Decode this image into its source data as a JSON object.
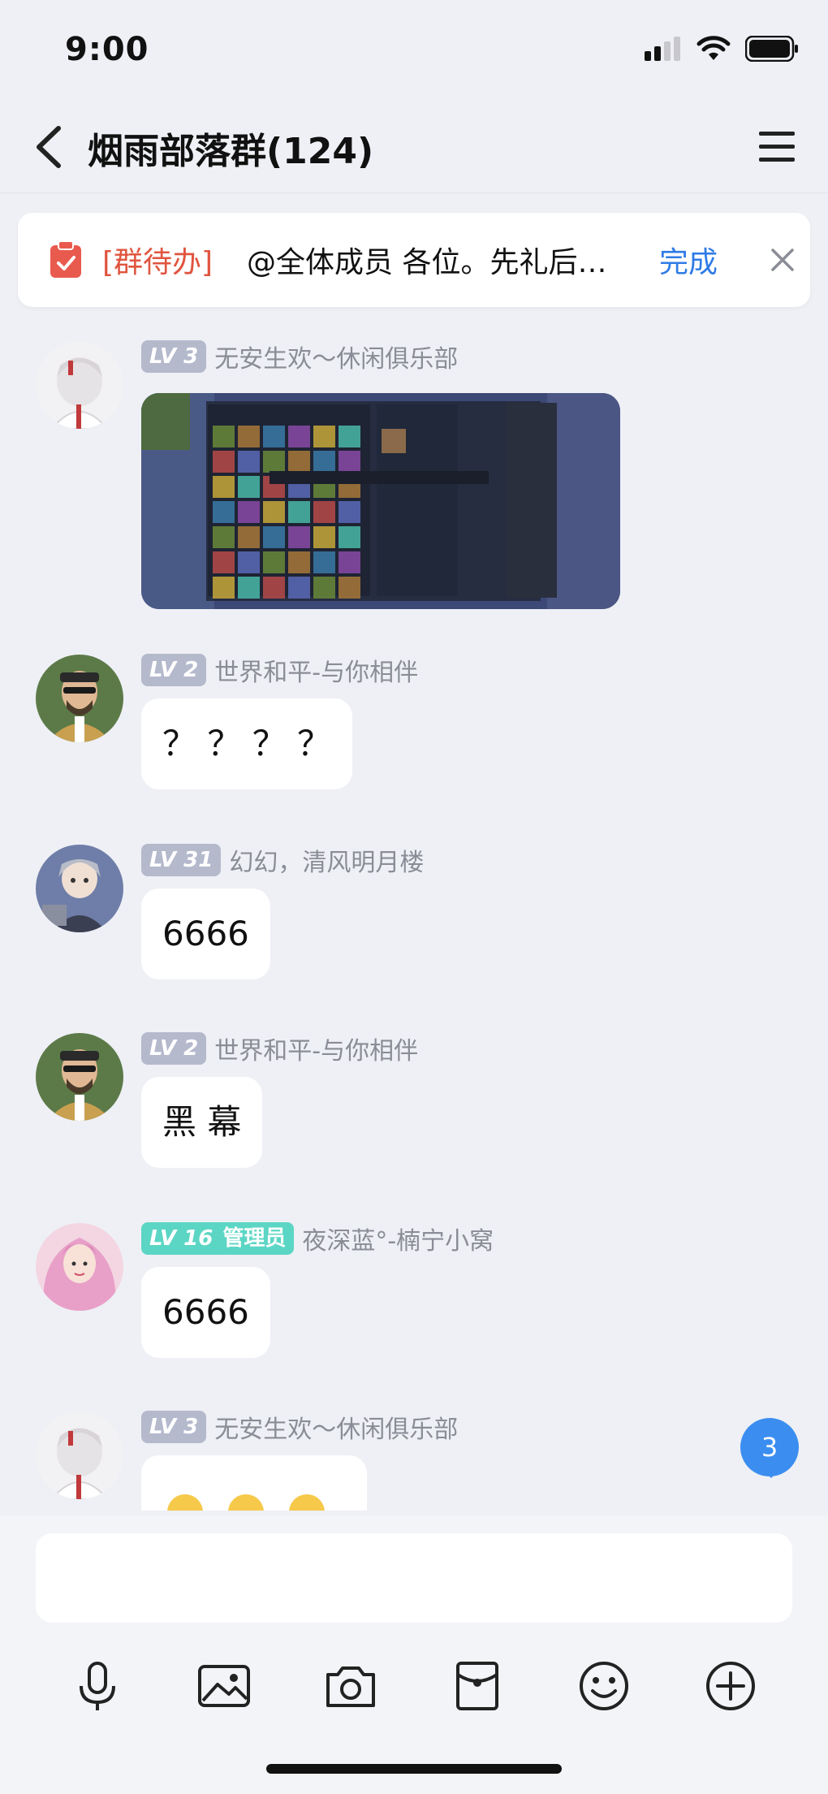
{
  "status_bar": {
    "time": "9:00"
  },
  "header": {
    "title": "烟雨部落群(124)"
  },
  "todo": {
    "tag": "[群待办]",
    "text": "@全体成员 各位。先礼后…",
    "done_label": "完成"
  },
  "messages": [
    {
      "level": "LV 3",
      "sender": "无安生欢～休闲俱乐部",
      "type": "image"
    },
    {
      "level": "LV 2",
      "sender": "世界和平-与你相伴",
      "text": "？ ？ ？ ？"
    },
    {
      "level": "LV 31",
      "sender": "幻幻，清风明月楼",
      "text": "6666"
    },
    {
      "level": "LV 2",
      "sender": "世界和平-与你相伴",
      "text": "黑 幕"
    },
    {
      "level": "LV 16",
      "role": "管理员",
      "sender": "夜深蓝°-楠宁小窝",
      "text": "6666"
    },
    {
      "level": "LV 3",
      "sender": "无安生欢～休闲俱乐部",
      "type": "emoji"
    }
  ],
  "unread_count": "3",
  "toolbar": {
    "icons": [
      "microphone-icon",
      "image-icon",
      "camera-icon",
      "red-packet-icon",
      "emoji-icon",
      "plus-icon"
    ]
  },
  "colors": {
    "accent_blue": "#2f7be6",
    "todo_tag_red": "#e0553f",
    "level_badge_gray": "#b4b9cc",
    "admin_badge_teal": "#5cd6c4",
    "unread_badge": "#3b8ef0"
  }
}
